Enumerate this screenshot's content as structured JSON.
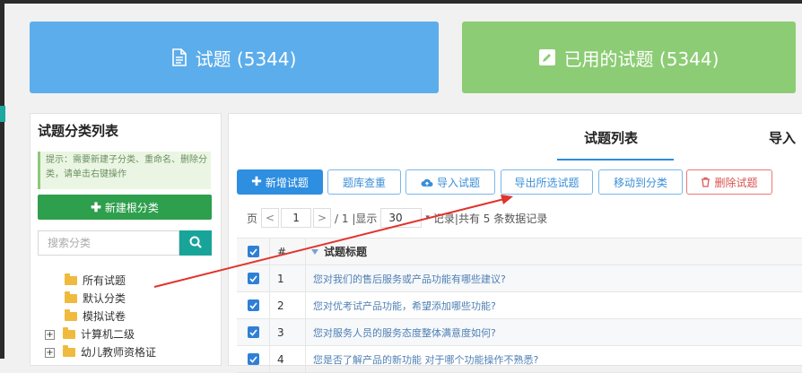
{
  "cards": {
    "questions": {
      "label": "试题 (5344)",
      "icon": "document-icon",
      "color": "#5cadeb"
    },
    "used": {
      "label": "已用的试题 (5344)",
      "icon": "edit-icon",
      "color": "#8ccc74"
    }
  },
  "sidebar": {
    "title": "试题分类列表",
    "tip": "提示：需要新建子分类、重命名、删除分类，请单击右键操作",
    "new_root_label": "新建根分类",
    "search_placeholder": "搜索分类",
    "items": [
      {
        "label": "所有试题",
        "expandable": false
      },
      {
        "label": "默认分类",
        "expandable": false
      },
      {
        "label": "模拟试卷",
        "expandable": false
      },
      {
        "label": "计算机二级",
        "expandable": true
      },
      {
        "label": "幼儿教师资格证",
        "expandable": true
      }
    ]
  },
  "tabs": [
    {
      "label": "试题列表",
      "active": true
    },
    {
      "label": "导入",
      "active": false
    }
  ],
  "toolbar": {
    "add": "新增试题",
    "dedupe": "题库查重",
    "import": "导入试题",
    "export": "导出所选试题",
    "move": "移动到分类",
    "delete": "删除试题"
  },
  "pager": {
    "page_label": "页",
    "prev": "<",
    "current": "1",
    "next": ">",
    "total": "/ 1 |显示",
    "per_page": "30",
    "records": "记录|共有 5 条数据记录"
  },
  "table": {
    "headers": {
      "num": "#",
      "title": "试题标题"
    },
    "rows": [
      {
        "num": "1",
        "title": "您对我们的售后服务或产品功能有哪些建议?"
      },
      {
        "num": "2",
        "title": "您对优考试产品功能，希望添加哪些功能?"
      },
      {
        "num": "3",
        "title": "您对服务人员的服务态度整体满意度如何?"
      },
      {
        "num": "4",
        "title": "您是否了解产品的新功能 对于哪个功能操作不熟悉?"
      }
    ]
  },
  "colors": {
    "accent": "#2e8ee0",
    "green": "#2e9f4d",
    "teal": "#19a49a",
    "annotation": "#e0342c"
  }
}
